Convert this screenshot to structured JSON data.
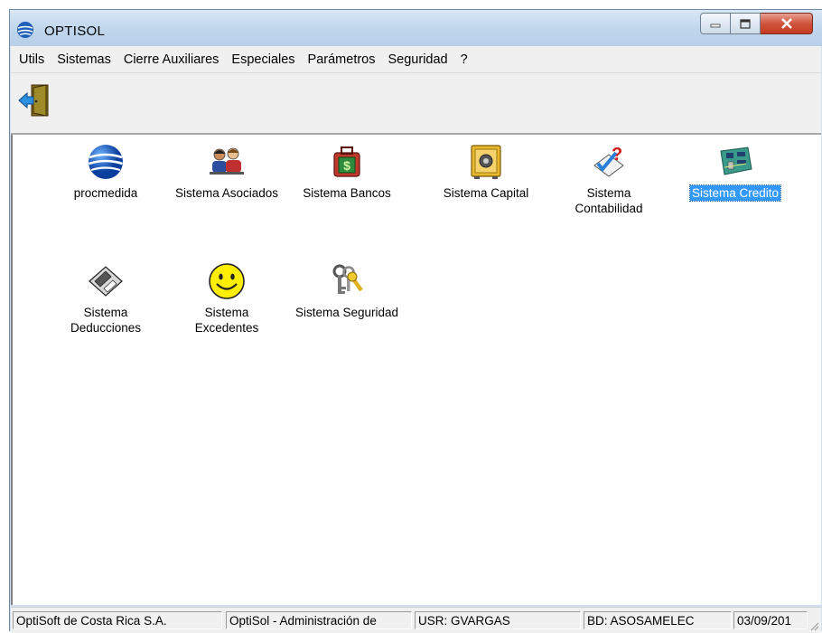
{
  "window": {
    "title": "OPTISOL"
  },
  "menu": [
    "Utils",
    "Sistemas",
    "Cierre Auxiliares",
    "Especiales",
    "Parámetros",
    "Seguridad",
    "?"
  ],
  "toolbar": {
    "exit_icon": "exit-door-icon"
  },
  "items": [
    {
      "label": "procmedida",
      "icon": "globe-icon"
    },
    {
      "label": "Sistema Asociados",
      "icon": "people-icon"
    },
    {
      "label": "Sistema Bancos",
      "icon": "money-bag-icon"
    },
    {
      "label": "Sistema Capital",
      "icon": "safe-icon"
    },
    {
      "label": "Sistema Contabilidad",
      "icon": "checklist-question-icon"
    },
    {
      "label": "Sistema Credito",
      "icon": "circuit-board-icon",
      "selected": true
    },
    {
      "label": "Sistema Deducciones",
      "icon": "diskette-icon"
    },
    {
      "label": "Sistema Excedentes",
      "icon": "smiley-icon"
    },
    {
      "label": "Sistema Seguridad",
      "icon": "keys-icon"
    }
  ],
  "status": {
    "company": "OptiSoft de Costa Rica S.A.",
    "module": "OptiSol - Administración de",
    "user": "USR: GVARGAS",
    "db": "BD: ASOSAMELEC",
    "date": "03/09/201"
  }
}
